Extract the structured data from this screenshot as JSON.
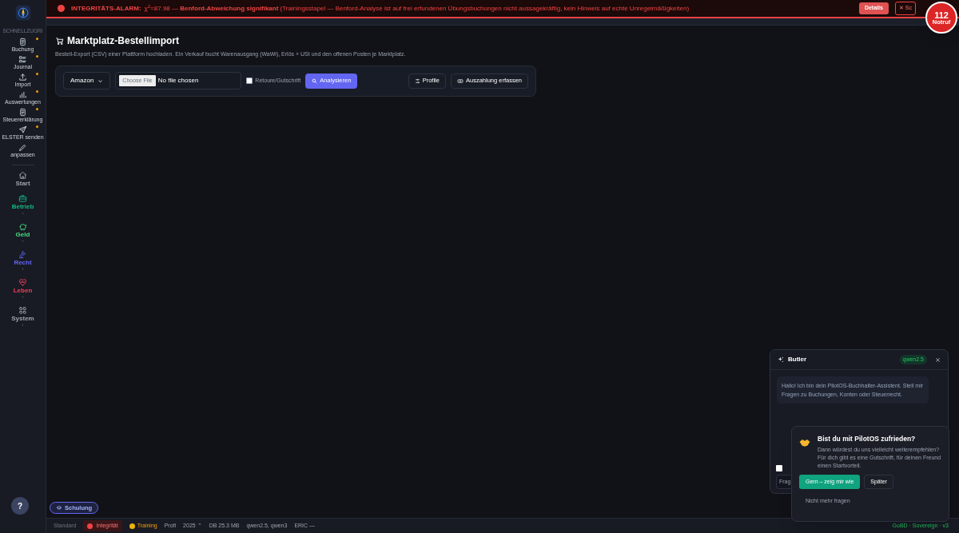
{
  "alarm": {
    "title": "INTEGRITÄTS-ALARM:",
    "message": "χ$^{2}$=87.98 — **Benford-Abweichung signifikant** (Trainingsstapel — Benford-Analyse ist auf frei erfundenen Übungsbuchungen nicht aussagekräftig, kein Hinweis auf echte Unregelmäßigkeiten)",
    "details": "Details",
    "close": "✕ Sc"
  },
  "emergency": {
    "number": "112",
    "label": "Notruf"
  },
  "sidebar": {
    "section": "SCHNELLZUGRI",
    "favorites": [
      {
        "label": "Buchung",
        "starred": true
      },
      {
        "label": "Journal",
        "starred": true
      },
      {
        "label": "Import",
        "starred": true
      },
      {
        "label": "Auswertungen",
        "starred": true
      },
      {
        "label": "Steuererklärung",
        "starred": true
      },
      {
        "label": "ELSTER senden",
        "starred": true
      },
      {
        "label": "anpassen",
        "starred": false
      }
    ],
    "areas": [
      {
        "label": "Start",
        "color": "#9ca3af"
      },
      {
        "label": "Betrieb",
        "color": "#10b981",
        "chevron": "›"
      },
      {
        "label": "Geld",
        "color": "#4ade80",
        "chevron": "›"
      },
      {
        "label": "Recht",
        "color": "#6366f1",
        "chevron": "›"
      },
      {
        "label": "Leben",
        "color": "#f43f5e",
        "chevron": "›"
      },
      {
        "label": "System",
        "color": "#9ca3af",
        "chevron": "›"
      }
    ]
  },
  "page": {
    "title": "Marktplatz-Bestellimport",
    "subtitle": "Bestell-Export (CSV) einer Plattform hochladen. Ein Verkauf bucht Warenausgang (WaWi), Erlös + USt und den offenen Posten je Marktplatz."
  },
  "toolbar": {
    "platform": "Amazon",
    "file_button": "Choose File",
    "file_status": "No file chosen",
    "return_label": "Retoure/Gutschrift",
    "return_checked": false,
    "analyze": "Analysieren",
    "profiles": "Profile",
    "payout": "Auszahlung erfassen"
  },
  "chat": {
    "title": "Butler",
    "model": "qwen2.5",
    "greeting": "Hallo! Ich bin dein PilotOS-Buchhalter-Assistent. Stell mir Fragen zu Buchungen, Konten oder Steuerrecht.",
    "input_visible": "Frag",
    "option_checked": false
  },
  "survey": {
    "title": "Bist du mit PilotOS zufrieden?",
    "text": "Dann würdest du uns vielleicht weiterempfehlen? Für dich gibt es eine Gutschrift, für deinen Freund einen Startvorteil.",
    "accept": "Gern – zeig mir wie",
    "later": "Später",
    "never": "Nicht mehr fragen"
  },
  "help": "?",
  "training_button": "Schulung",
  "status_bar": [
    {
      "kind": "muted",
      "label": "Standard"
    },
    {
      "kind": "pill",
      "label": "Integrität",
      "color": "#ef4444"
    },
    {
      "kind": "dot",
      "label": "Training",
      "color": "#eab308"
    },
    {
      "kind": "plain",
      "label": "Profi"
    },
    {
      "kind": "plain",
      "label": "2025 ⌃"
    },
    {
      "kind": "plain",
      "label": "DB 25.3 MB"
    },
    {
      "kind": "plain",
      "label": "qwen2.5, qwen3"
    },
    {
      "kind": "plain",
      "label": "ERIC —"
    }
  ],
  "status_right": "GoBD · Sovereign · v3"
}
